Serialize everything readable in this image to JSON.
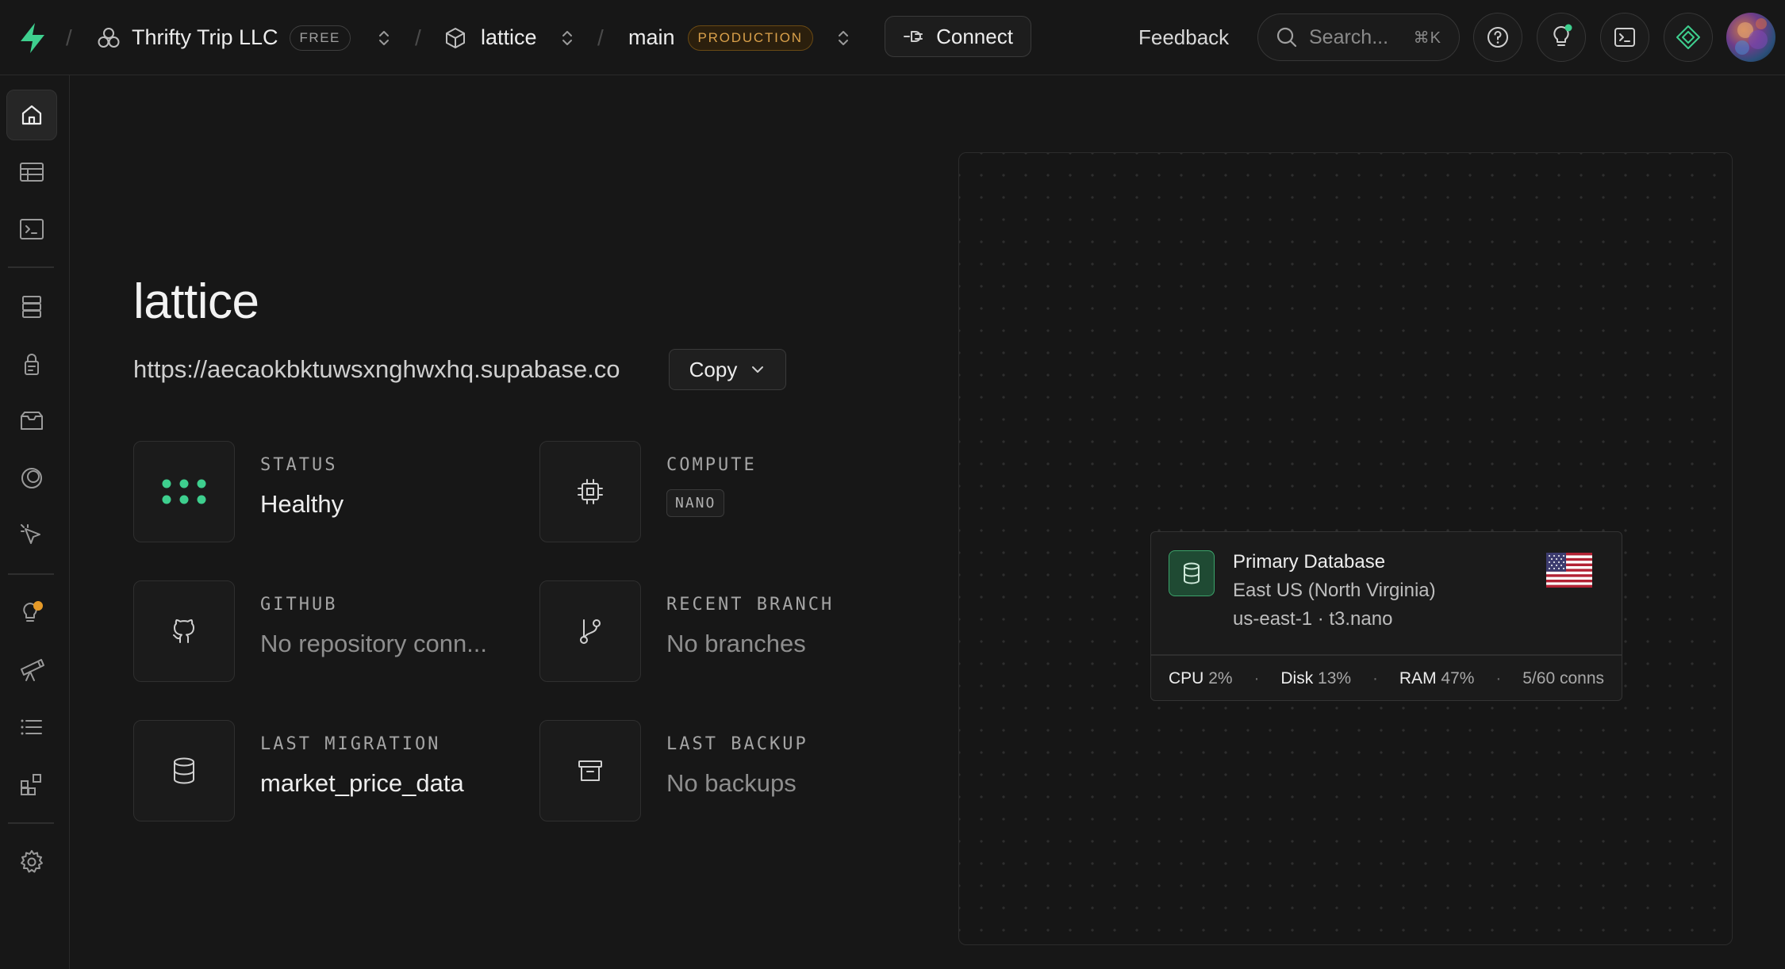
{
  "header": {
    "org_name": "Thrifty Trip LLC",
    "org_plan": "FREE",
    "project_name": "lattice",
    "branch_name": "main",
    "branch_env": "PRODUCTION",
    "connect_label": "Connect",
    "feedback_label": "Feedback",
    "search_placeholder": "Search...",
    "search_shortcut": "⌘K",
    "separator": "/"
  },
  "sidebar": {
    "items": [
      {
        "icon": "home-icon",
        "active": true
      },
      {
        "icon": "table-editor-icon"
      },
      {
        "icon": "sql-editor-icon"
      },
      {
        "icon": "database-icon"
      },
      {
        "icon": "auth-icon"
      },
      {
        "icon": "storage-icon"
      },
      {
        "icon": "realtime-icon"
      },
      {
        "icon": "edge-functions-icon"
      },
      {
        "icon": "advisors-icon"
      },
      {
        "icon": "reports-icon"
      },
      {
        "icon": "logs-icon"
      },
      {
        "icon": "integrations-icon"
      },
      {
        "icon": "settings-icon"
      }
    ]
  },
  "project": {
    "title": "lattice",
    "url": "https://aecaokbktuwsxnghwxhq.supabase.co",
    "copy_label": "Copy"
  },
  "cards": {
    "status": {
      "label": "STATUS",
      "value": "Healthy"
    },
    "compute": {
      "label": "COMPUTE",
      "value": "NANO"
    },
    "github": {
      "label": "GITHUB",
      "value": "No repository conn..."
    },
    "recent_branch": {
      "label": "RECENT BRANCH",
      "value": "No branches"
    },
    "last_migration": {
      "label": "LAST MIGRATION",
      "value": "market_price_data"
    },
    "last_backup": {
      "label": "LAST BACKUP",
      "value": "No backups"
    }
  },
  "database": {
    "name": "Primary Database",
    "region": "East US (North Virginia)",
    "instance": "us-east-1 · t3.nano",
    "metrics": {
      "cpu_label": "CPU",
      "cpu_value": "2%",
      "disk_label": "Disk",
      "disk_value": "13%",
      "ram_label": "RAM",
      "ram_value": "47%",
      "conns": "5/60 conns"
    }
  },
  "colors": {
    "accent_green": "#3ecf8e",
    "production_orange": "#d9a04a",
    "background": "#171717"
  }
}
